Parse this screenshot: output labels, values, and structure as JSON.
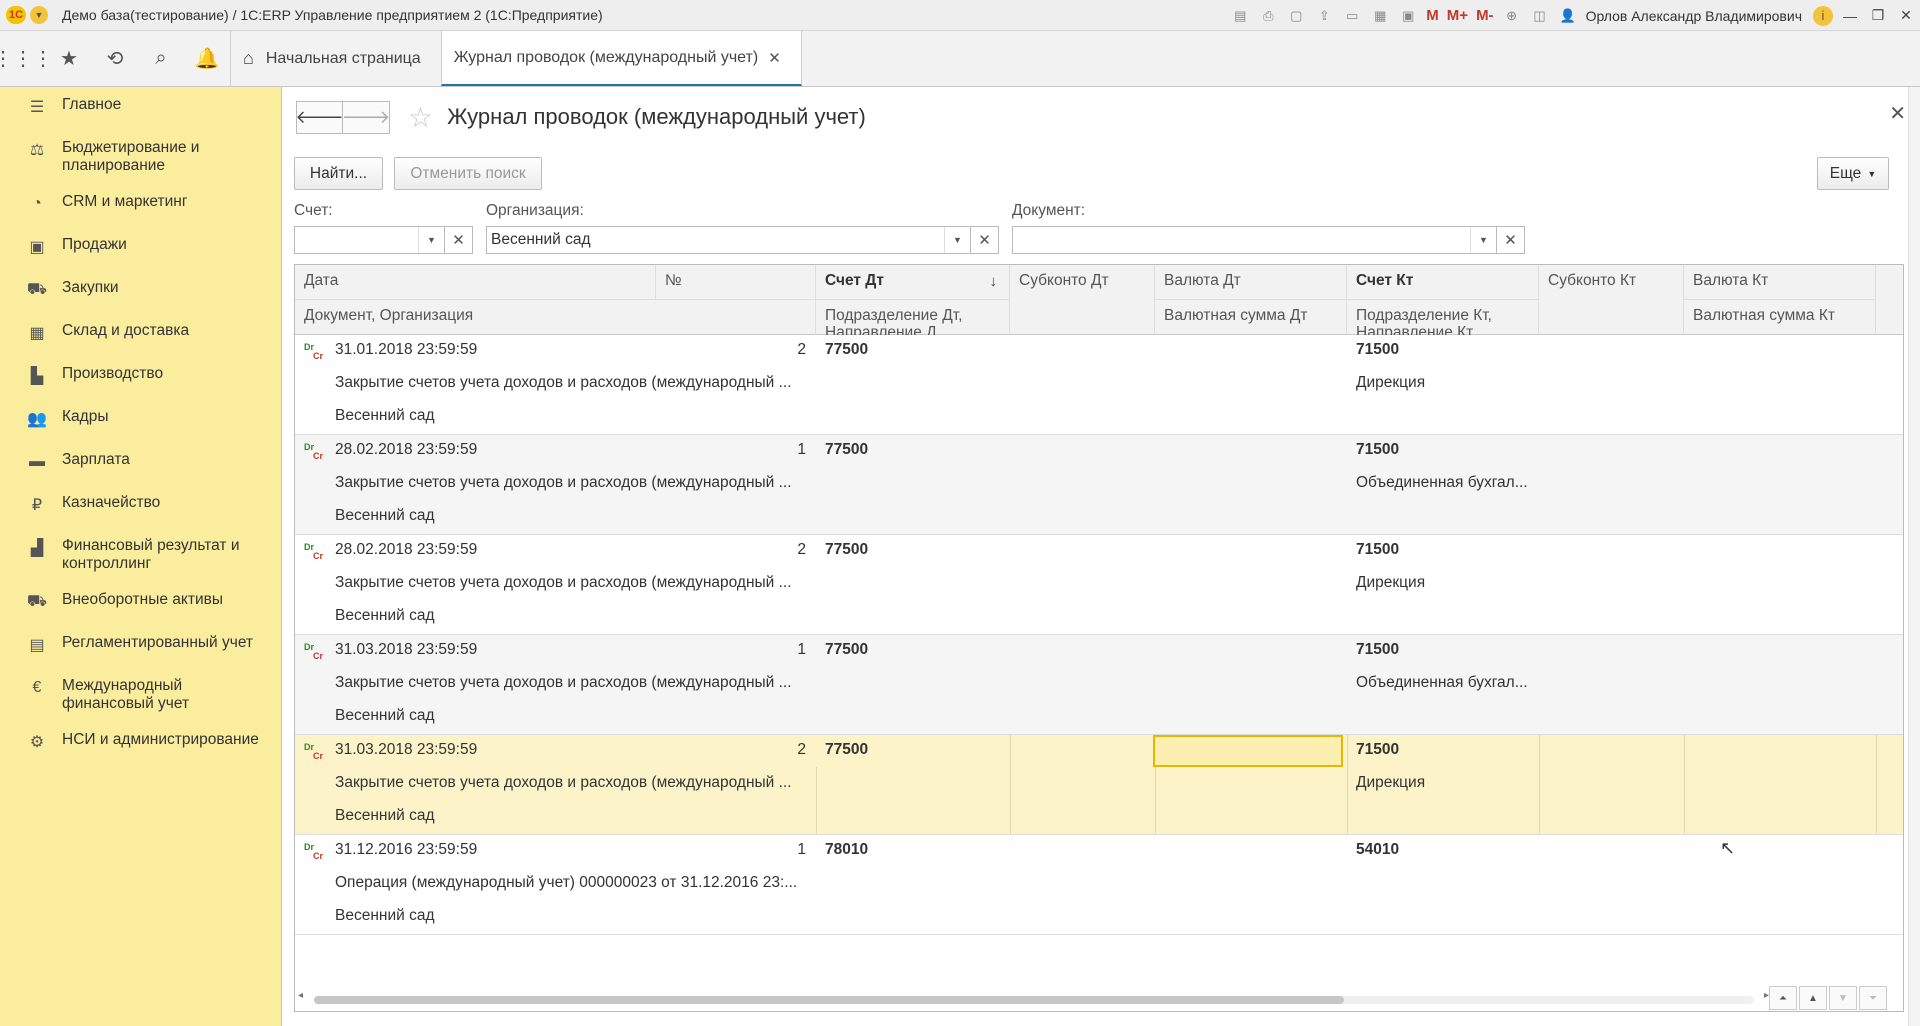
{
  "title_bar": {
    "app_logo": "1С",
    "title": "Демо база(тестирование) / 1С:ERP Управление предприятием 2  (1С:Предприятие)",
    "m_labels": [
      "M",
      "M+",
      "M-"
    ],
    "user": "Орлов Александр Владимирович"
  },
  "nav": {
    "tabs": [
      {
        "label": "Начальная страница",
        "icon": "home-icon"
      },
      {
        "label": "Журнал проводок (международный учет)",
        "active": true
      }
    ]
  },
  "sidebar": {
    "items": [
      {
        "label": "Главное",
        "icon": "menu-icon"
      },
      {
        "label": "Бюджетирование и планирование",
        "icon": "budget-icon"
      },
      {
        "label": "CRM и маркетинг",
        "icon": "pie-chart-icon"
      },
      {
        "label": "Продажи",
        "icon": "bag-icon"
      },
      {
        "label": "Закупки",
        "icon": "cart-icon"
      },
      {
        "label": "Склад и доставка",
        "icon": "warehouse-icon"
      },
      {
        "label": "Производство",
        "icon": "factory-icon"
      },
      {
        "label": "Кадры",
        "icon": "people-icon"
      },
      {
        "label": "Зарплата",
        "icon": "card-icon"
      },
      {
        "label": "Казначейство",
        "icon": "ruble-icon"
      },
      {
        "label": "Финансовый результат и контроллинг",
        "icon": "bar-chart-icon"
      },
      {
        "label": "Внеоборотные активы",
        "icon": "truck-icon"
      },
      {
        "label": "Регламентированный учет",
        "icon": "document-icon"
      },
      {
        "label": "Международный финансовый учет",
        "icon": "euro-icon"
      },
      {
        "label": "НСИ и администрирование",
        "icon": "gear-icon"
      }
    ]
  },
  "form": {
    "title": "Журнал проводок (международный учет)",
    "find_label": "Найти...",
    "cancel_search_label": "Отменить поиск",
    "more_label": "Еще",
    "filters": {
      "account": {
        "label": "Счет:",
        "value": ""
      },
      "organization": {
        "label": "Организация:",
        "value": "Весенний сад"
      },
      "document": {
        "label": "Документ:",
        "value": ""
      }
    }
  },
  "grid": {
    "headers": {
      "date": "Дата",
      "number": "№",
      "doc_org": "Документ, Организация",
      "account_dt": "Счет Дт",
      "division_dt": "Подразделение Дт, Направление Д...",
      "subconto_dt": "Субконто Дт",
      "currency_dt": "Валюта Дт",
      "currency_amount_dt": "Валютная сумма Дт",
      "account_kt": "Счет Кт",
      "division_kt": "Подразделение Кт, Направление Кт",
      "subconto_kt": "Субконто Кт",
      "currency_kt": "Валюта Кт",
      "currency_amount_kt": "Валютная сумма Кт"
    },
    "rows": [
      {
        "date": "31.01.2018 23:59:59",
        "num": "2",
        "doc": "Закрытие счетов учета доходов и расходов (международный ...",
        "org": "Весенний сад",
        "account_dt": "77500",
        "account_kt": "71500",
        "division_kt": "Дирекция"
      },
      {
        "date": "28.02.2018 23:59:59",
        "num": "1",
        "doc": "Закрытие счетов учета доходов и расходов (международный ...",
        "org": "Весенний сад",
        "account_dt": "77500",
        "account_kt": "71500",
        "division_kt": "Объединенная бухгал..."
      },
      {
        "date": "28.02.2018 23:59:59",
        "num": "2",
        "doc": "Закрытие счетов учета доходов и расходов (международный ...",
        "org": "Весенний сад",
        "account_dt": "77500",
        "account_kt": "71500",
        "division_kt": "Дирекция"
      },
      {
        "date": "31.03.2018 23:59:59",
        "num": "1",
        "doc": "Закрытие счетов учета доходов и расходов (международный ...",
        "org": "Весенний сад",
        "account_dt": "77500",
        "account_kt": "71500",
        "division_kt": "Объединенная бухгал..."
      },
      {
        "date": "31.03.2018 23:59:59",
        "num": "2",
        "doc": "Закрытие счетов учета доходов и расходов (международный ...",
        "org": "Весенний сад",
        "account_dt": "77500",
        "account_kt": "71500",
        "division_kt": "Дирекция",
        "selected": true
      },
      {
        "date": "31.12.2016 23:59:59",
        "num": "1",
        "doc": "Операция (международный учет) 000000023 от 31.12.2016 23:...",
        "org": "Весенний сад",
        "account_dt": "78010",
        "account_kt": "54010",
        "division_kt": ""
      }
    ],
    "drcr_dr": "Dr",
    "drcr_cr": "Cr"
  },
  "colors": {
    "sidebar_bg": "#fbed9e",
    "selected_row": "#fdf3c9",
    "selected_cell_border": "#e6b700",
    "active_tab_underline": "#2277aa"
  }
}
